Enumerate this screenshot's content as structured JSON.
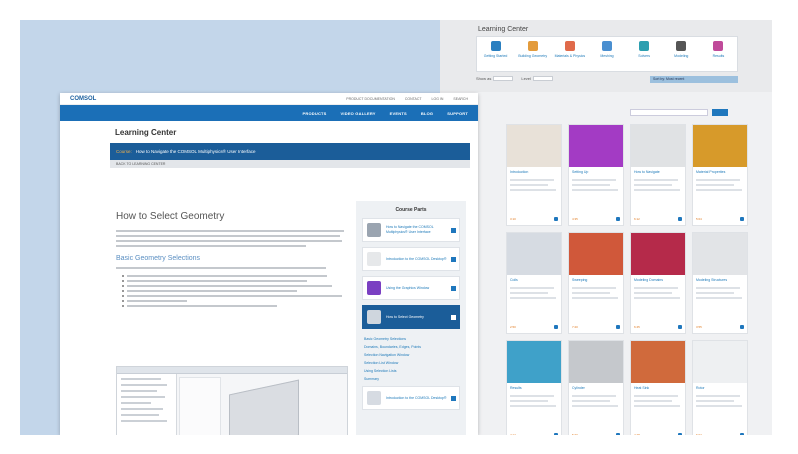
{
  "back_page": {
    "title": "Learning Center",
    "categories": [
      {
        "label": "Getting Started",
        "color": "#2a7fc0"
      },
      {
        "label": "Building Geometry",
        "color": "#e39b3c"
      },
      {
        "label": "Materials & Physics",
        "color": "#e06a4a"
      },
      {
        "label": "Meshing",
        "color": "#4a8fd0"
      },
      {
        "label": "Solvers",
        "color": "#2c9fb0"
      },
      {
        "label": "Modeling",
        "color": "#555555"
      },
      {
        "label": "Results",
        "color": "#c04a9a"
      }
    ],
    "filters": [
      {
        "label": "Show as"
      },
      {
        "label": "Level"
      }
    ],
    "filter_right": "Sort by: Most recent"
  },
  "grid_cards": [
    {
      "title": "Introduction",
      "thumb": "#e8e1d8",
      "foot": "3:10"
    },
    {
      "title": "Setting Up",
      "thumb": "#a33bc4",
      "foot": "4:35"
    },
    {
      "title": "How to Navigate",
      "thumb": "#e0e2e4",
      "foot": "6:12"
    },
    {
      "title": "Material Properties",
      "thumb": "#d79a2a",
      "foot": "5:04"
    },
    {
      "title": "Coils",
      "thumb": "#d6dbe2",
      "foot": "2:50"
    },
    {
      "title": "Sweeping",
      "thumb": "#d0583a",
      "foot": "7:20"
    },
    {
      "title": "Modeling Domains",
      "thumb": "#b52a4a",
      "foot": "6:45"
    },
    {
      "title": "Modeling Structures",
      "thumb": "#e2e4e7",
      "foot": "3:55"
    },
    {
      "title": "Results",
      "thumb": "#3fa1c9",
      "foot": "4:12"
    },
    {
      "title": "Cylinder",
      "thumb": "#c5c8cc",
      "foot": "5:30"
    },
    {
      "title": "Heat Sink",
      "thumb": "#d06a3c",
      "foot": "4:48"
    },
    {
      "title": "Rotor",
      "thumb": "#eef0f2",
      "foot": "6:02"
    }
  ],
  "front_page": {
    "logo": "COMSOL",
    "util_links": [
      "PRODUCT DOCUMENTATION",
      "CONTACT",
      "LOG IN",
      "SEARCH"
    ],
    "nav": [
      "PRODUCTS",
      "VIDEO GALLERY",
      "EVENTS",
      "BLOG",
      "SUPPORT"
    ],
    "learning_center": "Learning Center",
    "course_key": "Course:",
    "course_value": "How to Navigate the COMSOL Multiphysics® User Interface",
    "back_link": "BACK TO LEARNING CENTER",
    "article_title": "How to Select Geometry",
    "section_title": "Basic Geometry Selections",
    "sidebar_title": "Course Parts",
    "sidebar_items": [
      {
        "label": "How to Navigate the COMSOL Multiphysics® User Interface",
        "color": "#9aa4b0",
        "active": false
      },
      {
        "label": "Introduction to the COMSOL Desktop®",
        "color": "#e6e8ea",
        "active": false
      },
      {
        "label": "Using the Graphics Window",
        "color": "#7a3fc2",
        "active": false
      },
      {
        "label": "How to Select Geometry",
        "color": "#cfd6de",
        "active": true
      }
    ],
    "sidebar_links": [
      "Basic Geometry Selections",
      "Domains, Boundaries, Edges, Points",
      "Selection Navigation Window",
      "Selection List Window",
      "Using Selection Lists",
      "Summary"
    ],
    "sidebar_bottom": "Introduction to the COMSOL Desktop®"
  }
}
